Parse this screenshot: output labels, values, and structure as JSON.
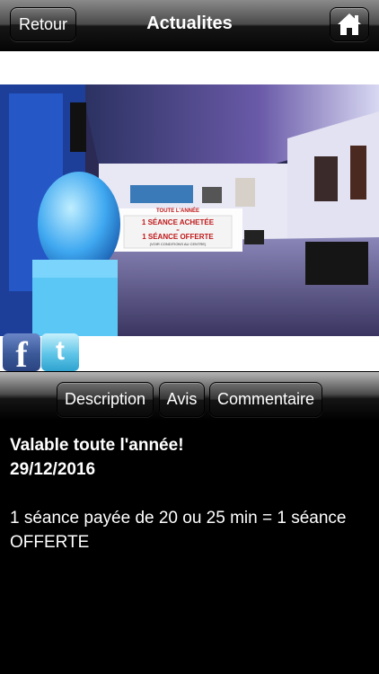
{
  "header": {
    "back_label": "Retour",
    "title": "Actualites",
    "home_icon": "home-icon"
  },
  "photo": {
    "sign_line1": "TOUTE L'ANNÉE",
    "sign_line2": "1 SÉANCE ACHETÉE",
    "sign_line3": "=",
    "sign_line4": "1 SÉANCE OFFERTE",
    "sign_line5": "(VOIR CONDITIONS AU CENTRE)"
  },
  "social": {
    "facebook_icon": "facebook-icon",
    "twitter_icon": "twitter-icon"
  },
  "tabs": [
    {
      "label": "Description"
    },
    {
      "label": "Avis"
    },
    {
      "label": "Commentaire"
    }
  ],
  "article": {
    "headline": "Valable toute l'année!",
    "date": "29/12/2016",
    "body": "1 séance payée de 20 ou 25 min = 1 séance OFFERTE"
  }
}
